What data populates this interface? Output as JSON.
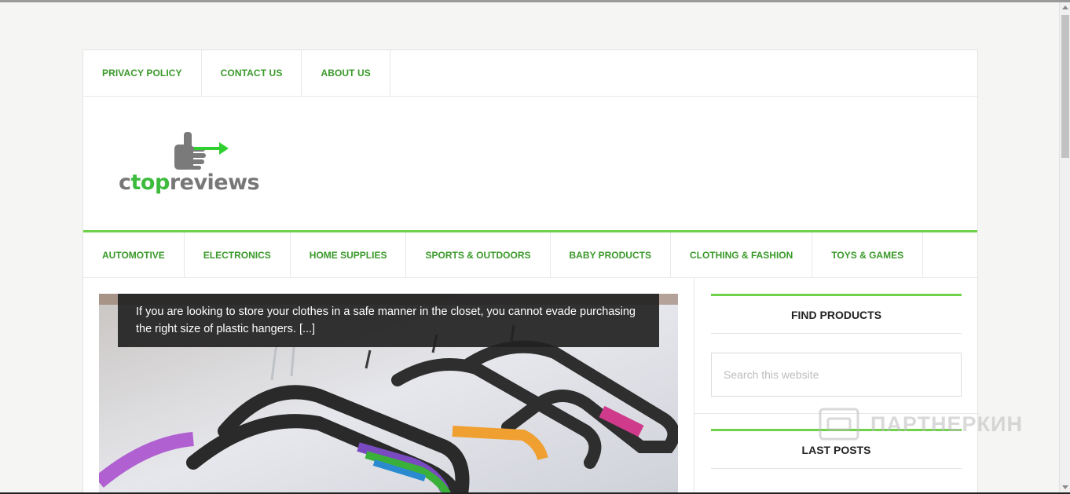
{
  "top_nav": [
    {
      "label": "PRIVACY POLICY"
    },
    {
      "label": "CONTACT US"
    },
    {
      "label": "ABOUT US"
    }
  ],
  "logo": {
    "text_dark": "c",
    "text_green": "top",
    "text_tail": "reviews"
  },
  "main_nav": [
    {
      "label": "AUTOMOTIVE"
    },
    {
      "label": "ELECTRONICS"
    },
    {
      "label": "HOME SUPPLIES"
    },
    {
      "label": "SPORTS & OUTDOORS"
    },
    {
      "label": "BABY PRODUCTS"
    },
    {
      "label": "CLOTHING & FASHION"
    },
    {
      "label": "TOYS & GAMES"
    }
  ],
  "featured_post": {
    "excerpt": "If you are looking to store your clothes in a safe manner in the closet, you cannot evade purchasing the right size of plastic hangers. [...]",
    "image": "plastic-hangers-photo"
  },
  "sidebar": {
    "find_products": {
      "title": "FIND PRODUCTS",
      "search_placeholder": "Search this website"
    },
    "last_posts": {
      "title": "LAST POSTS"
    }
  },
  "watermark": {
    "text": "ПАРТНЕРКИН"
  },
  "colors": {
    "accent_green": "#6fd24a",
    "link_green": "#3a9a2a",
    "excerpt_bg": "#222222"
  }
}
